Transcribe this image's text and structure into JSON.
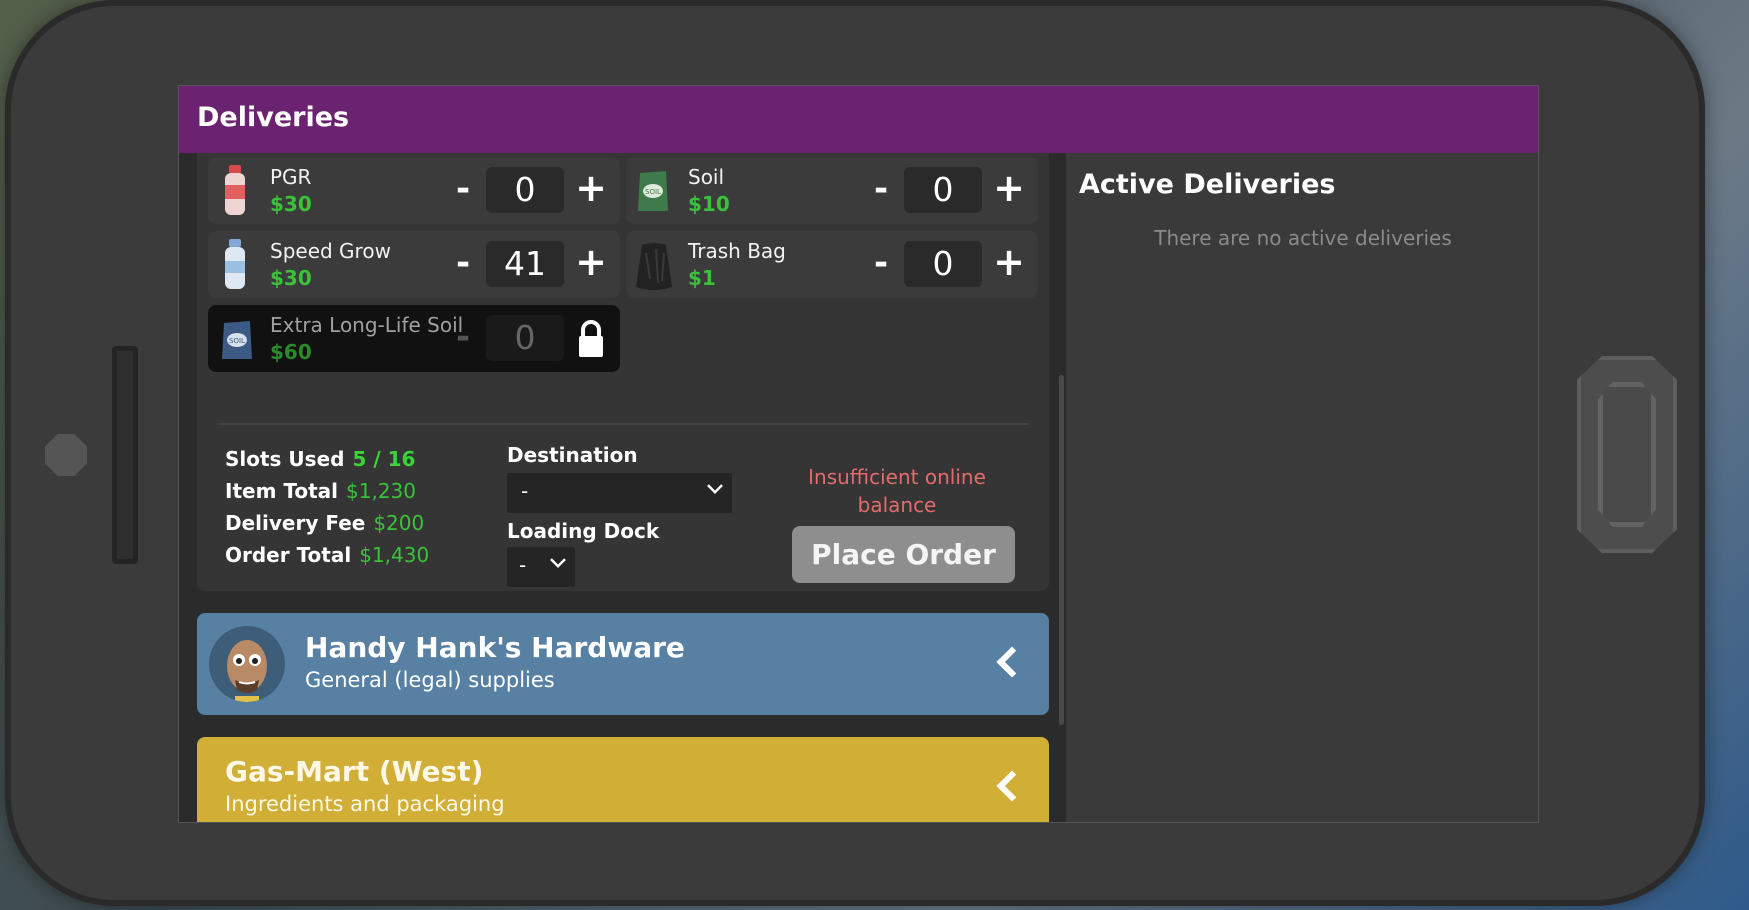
{
  "app": {
    "title": "Deliveries"
  },
  "items": [
    {
      "name": "PGR",
      "price": "$30",
      "qty": "0",
      "minus": "-",
      "plus": "+",
      "locked": false,
      "icon": "pgr-bottle-icon"
    },
    {
      "name": "Soil",
      "price": "$10",
      "qty": "0",
      "minus": "-",
      "plus": "+",
      "locked": false,
      "icon": "soil-bag-icon"
    },
    {
      "name": "Speed Grow",
      "price": "$30",
      "qty": "41",
      "minus": "-",
      "plus": "+",
      "locked": false,
      "icon": "speed-grow-bottle-icon"
    },
    {
      "name": "Trash Bag",
      "price": "$1",
      "qty": "0",
      "minus": "-",
      "plus": "+",
      "locked": false,
      "icon": "trash-bag-icon"
    },
    {
      "name": "Extra Long-Life Soil",
      "price": "$60",
      "qty": "0",
      "minus": "-",
      "locked": true,
      "icon": "extra-soil-bag-icon"
    }
  ],
  "summary": {
    "slots_label": "Slots Used",
    "slots_value": "5 / 16",
    "item_total_label": "Item Total",
    "item_total_value": "$1,230",
    "delivery_fee_label": "Delivery Fee",
    "delivery_fee_value": "$200",
    "order_total_label": "Order Total",
    "order_total_value": "$1,430"
  },
  "destination": {
    "label": "Destination",
    "value": "-"
  },
  "loading_dock": {
    "label": "Loading Dock",
    "value": "-"
  },
  "warning": "Insufficient online balance",
  "place_order": "Place Order",
  "vendors": [
    {
      "name": "Handy Hank's Hardware",
      "subtitle": "General (legal) supplies",
      "color": "#5780a3"
    },
    {
      "name": "Gas-Mart (West)",
      "subtitle": "Ingredients and packaging",
      "color": "#d1ae36"
    }
  ],
  "active_deliveries": {
    "title": "Active Deliveries",
    "empty_text": "There are no active deliveries"
  },
  "colors": {
    "topbar": "#6b2270",
    "price_green": "#3ac23a",
    "warning_red": "#e36b6b"
  }
}
